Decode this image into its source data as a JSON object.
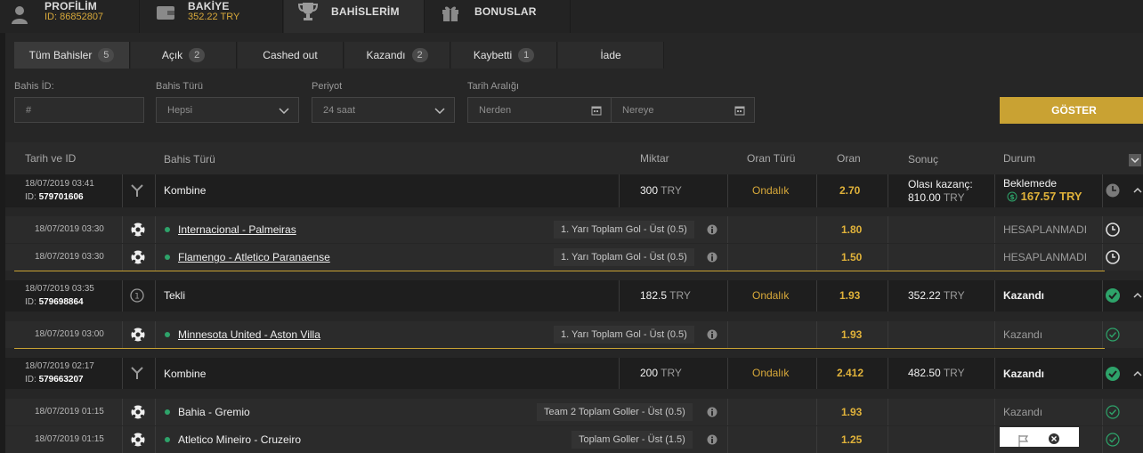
{
  "nav": {
    "profile_title": "PROFİLİM",
    "profile_id": "ID: 86852807",
    "balance_title": "BAKİYE",
    "balance_value": "352.22 TRY",
    "bets_title": "BAHİSLERİM",
    "bonus_title": "BONUSLAR"
  },
  "tabs": [
    {
      "label": "Tüm Bahisler",
      "count": "5"
    },
    {
      "label": "Açık",
      "count": "2"
    },
    {
      "label": "Cashed out",
      "count": ""
    },
    {
      "label": "Kazandı",
      "count": "2"
    },
    {
      "label": "Kaybetti",
      "count": "1"
    },
    {
      "label": "İade",
      "count": ""
    }
  ],
  "filters": {
    "bet_id_label": "Bahis İD:",
    "bet_id_placeholder": "#",
    "bet_type_label": "Bahis Türü",
    "bet_type_value": "Hepsi",
    "period_label": "Periyot",
    "period_value": "24 saat",
    "date_range_label": "Tarih Aralığı",
    "from_placeholder": "Nerden",
    "to_placeholder": "Nereye",
    "show_button": "GÖSTER"
  },
  "columns": {
    "date_id": "Tarih ve ID",
    "bet_type": "Bahis Türü",
    "amount": "Miktar",
    "odds_type": "Oran Türü",
    "odds": "Oran",
    "result": "Sonuç",
    "status": "Durum"
  },
  "bets": [
    {
      "date": "18/07/2019 03:41",
      "id_prefix": "ID:",
      "id": "579701606",
      "type": "Kombine",
      "amount": "300",
      "currency": "TRY",
      "odds_type": "Ondalık",
      "odds": "2.70",
      "result_label": "Olası kazanç:",
      "result_value": "810.00",
      "result_currency": "TRY",
      "status": "Beklemede",
      "status_amount": "167.57 TRY",
      "selections": [
        {
          "date": "18/07/2019 03:30",
          "match": "Internacional - Palmeiras",
          "market": "1. Yarı Toplam Gol - Üst (0.5)",
          "odds": "1.80",
          "status": "HESAPLANMADI"
        },
        {
          "date": "18/07/2019 03:30",
          "match": "Flamengo - Atletico Paranaense",
          "market": "1. Yarı Toplam Gol - Üst (0.5)",
          "odds": "1.50",
          "status": "HESAPLANMADI"
        }
      ]
    },
    {
      "date": "18/07/2019 03:35",
      "id_prefix": "ID:",
      "id": "579698864",
      "type": "Tekli",
      "amount": "182.5",
      "currency": "TRY",
      "odds_type": "Ondalık",
      "odds": "1.93",
      "result_value": "352.22",
      "result_currency": "TRY",
      "status": "Kazandı",
      "selections": [
        {
          "date": "18/07/2019 03:00",
          "match": "Minnesota United - Aston Villa",
          "market": "1. Yarı Toplam Gol - Üst (0.5)",
          "odds": "1.93",
          "status": "Kazandı"
        }
      ]
    },
    {
      "date": "18/07/2019 02:17",
      "id_prefix": "ID:",
      "id": "579663207",
      "type": "Kombine",
      "amount": "200",
      "currency": "TRY",
      "odds_type": "Ondalık",
      "odds": "2.412",
      "result_value": "482.50",
      "result_currency": "TRY",
      "status": "Kazandı",
      "selections": [
        {
          "date": "18/07/2019 01:15",
          "match": "Bahia - Gremio",
          "market": "Team 2 Toplam Goller - Üst (0.5)",
          "odds": "1.93",
          "status": "Kazandı"
        },
        {
          "date": "18/07/2019 01:15",
          "match": "Atletico Mineiro - Cruzeiro",
          "market": "Toplam Goller - Üst (1.5)",
          "odds": "1.25",
          "status": ""
        }
      ]
    }
  ],
  "colors": {
    "accent": "#c9a233",
    "win": "#2ea36a",
    "bg": "#1b1b1b"
  }
}
